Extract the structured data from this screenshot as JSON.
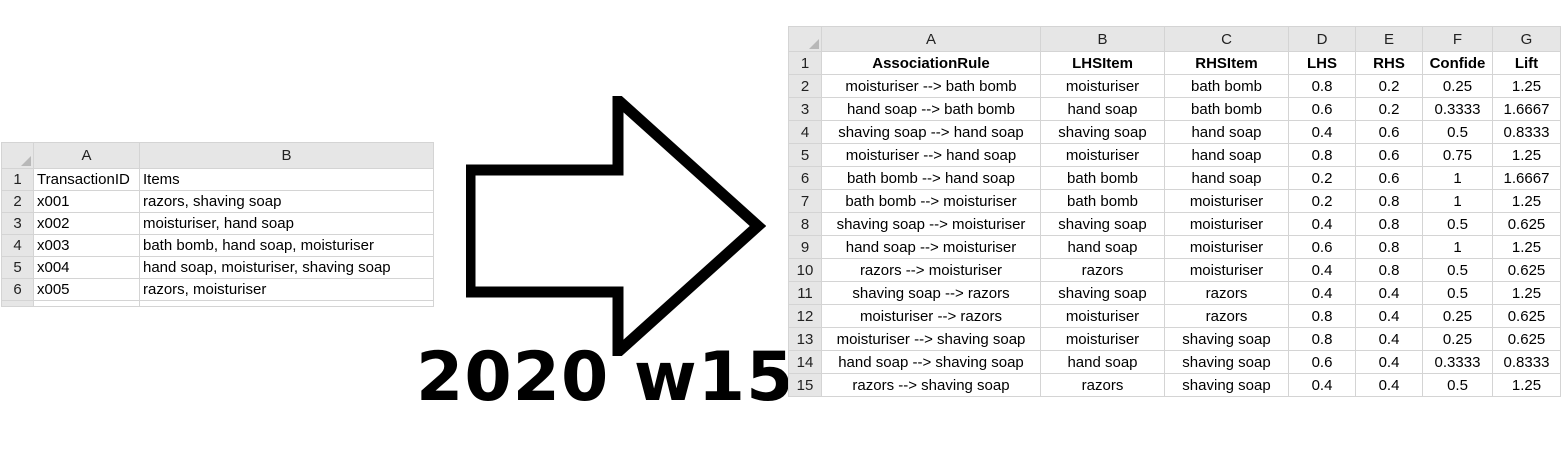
{
  "left_sheet": {
    "column_letters": [
      "A",
      "B"
    ],
    "rows": [
      {
        "num": "1",
        "cells": [
          "TransactionID",
          "Items"
        ]
      },
      {
        "num": "2",
        "cells": [
          "x001",
          "razors, shaving soap"
        ]
      },
      {
        "num": "3",
        "cells": [
          "x002",
          "moisturiser, hand soap"
        ]
      },
      {
        "num": "4",
        "cells": [
          "x003",
          "bath bomb, hand soap, moisturiser"
        ]
      },
      {
        "num": "5",
        "cells": [
          "x004",
          "hand soap, moisturiser, shaving soap"
        ]
      },
      {
        "num": "6",
        "cells": [
          "x005",
          "razors, moisturiser"
        ]
      }
    ]
  },
  "caption": "2020 w15",
  "right_sheet": {
    "column_letters": [
      "A",
      "B",
      "C",
      "D",
      "E",
      "F",
      "G"
    ],
    "header": {
      "num": "1",
      "cells": [
        "AssociationRule",
        "LHSItem",
        "RHSItem",
        "LHS",
        "RHS",
        "Confide",
        "Lift"
      ]
    },
    "rows": [
      {
        "num": "2",
        "cells": [
          "moisturiser --> bath bomb",
          "moisturiser",
          "bath bomb",
          "0.8",
          "0.2",
          "0.25",
          "1.25"
        ]
      },
      {
        "num": "3",
        "cells": [
          "hand soap --> bath bomb",
          "hand soap",
          "bath bomb",
          "0.6",
          "0.2",
          "0.3333",
          "1.6667"
        ]
      },
      {
        "num": "4",
        "cells": [
          "shaving soap --> hand soap",
          "shaving soap",
          "hand soap",
          "0.4",
          "0.6",
          "0.5",
          "0.8333"
        ]
      },
      {
        "num": "5",
        "cells": [
          "moisturiser --> hand soap",
          "moisturiser",
          "hand soap",
          "0.8",
          "0.6",
          "0.75",
          "1.25"
        ]
      },
      {
        "num": "6",
        "cells": [
          "bath bomb --> hand soap",
          "bath bomb",
          "hand soap",
          "0.2",
          "0.6",
          "1",
          "1.6667"
        ]
      },
      {
        "num": "7",
        "cells": [
          "bath bomb --> moisturiser",
          "bath bomb",
          "moisturiser",
          "0.2",
          "0.8",
          "1",
          "1.25"
        ]
      },
      {
        "num": "8",
        "cells": [
          "shaving soap --> moisturiser",
          "shaving soap",
          "moisturiser",
          "0.4",
          "0.8",
          "0.5",
          "0.625"
        ]
      },
      {
        "num": "9",
        "cells": [
          "hand soap --> moisturiser",
          "hand soap",
          "moisturiser",
          "0.6",
          "0.8",
          "1",
          "1.25"
        ]
      },
      {
        "num": "10",
        "cells": [
          "razors --> moisturiser",
          "razors",
          "moisturiser",
          "0.4",
          "0.8",
          "0.5",
          "0.625"
        ]
      },
      {
        "num": "11",
        "cells": [
          "shaving soap --> razors",
          "shaving soap",
          "razors",
          "0.4",
          "0.4",
          "0.5",
          "1.25"
        ]
      },
      {
        "num": "12",
        "cells": [
          "moisturiser --> razors",
          "moisturiser",
          "razors",
          "0.8",
          "0.4",
          "0.25",
          "0.625"
        ]
      },
      {
        "num": "13",
        "cells": [
          "moisturiser --> shaving soap",
          "moisturiser",
          "shaving soap",
          "0.8",
          "0.4",
          "0.25",
          "0.625"
        ]
      },
      {
        "num": "14",
        "cells": [
          "hand soap --> shaving soap",
          "hand soap",
          "shaving soap",
          "0.6",
          "0.4",
          "0.3333",
          "0.8333"
        ]
      },
      {
        "num": "15",
        "cells": [
          "razors --> shaving soap",
          "razors",
          "shaving soap",
          "0.4",
          "0.4",
          "0.5",
          "1.25"
        ]
      }
    ]
  },
  "colors": {
    "header_bg": "#e6e6e6",
    "grid": "#d4d4d4",
    "arrow": "#000000"
  },
  "icons": {
    "arrow": "right-arrow-icon",
    "corner": "select-all-corner-icon"
  }
}
